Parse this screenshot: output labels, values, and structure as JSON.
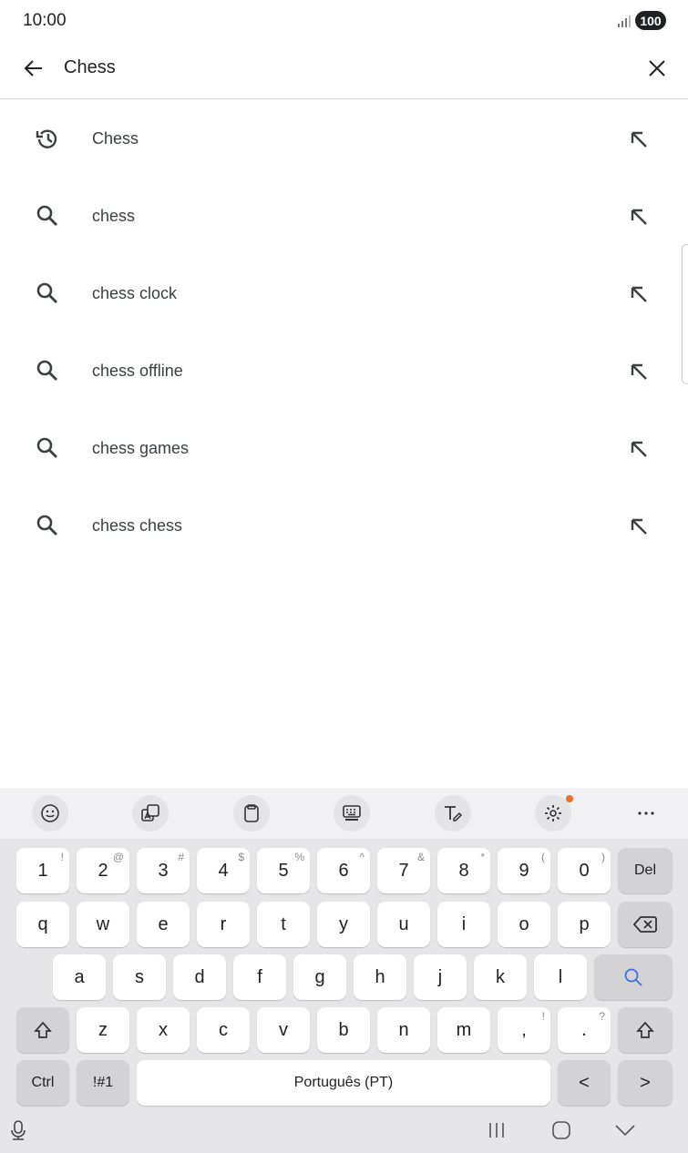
{
  "status_bar": {
    "time": "10:00",
    "battery": "100"
  },
  "search": {
    "value": "Chess"
  },
  "suggestions": [
    {
      "label": "Chess",
      "icon": "history-icon"
    },
    {
      "label": "chess",
      "icon": "search-icon"
    },
    {
      "label": "chess clock",
      "icon": "search-icon"
    },
    {
      "label": "chess offline",
      "icon": "search-icon"
    },
    {
      "label": "chess games",
      "icon": "search-icon"
    },
    {
      "label": "chess chess",
      "icon": "search-icon"
    }
  ],
  "keyboard": {
    "number_row": [
      {
        "main": "1",
        "sub": "!"
      },
      {
        "main": "2",
        "sub": "@"
      },
      {
        "main": "3",
        "sub": "#"
      },
      {
        "main": "4",
        "sub": "$"
      },
      {
        "main": "5",
        "sub": "%"
      },
      {
        "main": "6",
        "sub": "^"
      },
      {
        "main": "7",
        "sub": "&"
      },
      {
        "main": "8",
        "sub": "*"
      },
      {
        "main": "9",
        "sub": "("
      },
      {
        "main": "0",
        "sub": ")"
      }
    ],
    "del_label": "Del",
    "row_q": [
      "q",
      "w",
      "e",
      "r",
      "t",
      "y",
      "u",
      "i",
      "o",
      "p"
    ],
    "row_a": [
      "a",
      "s",
      "d",
      "f",
      "g",
      "h",
      "j",
      "k",
      "l"
    ],
    "row_z": [
      "z",
      "x",
      "c",
      "v",
      "b",
      "n",
      "m"
    ],
    "comma": {
      "main": ",",
      "sub": "!"
    },
    "period": {
      "main": ".",
      "sub": "?"
    },
    "ctrl_label": "Ctrl",
    "symbols_label": "!#1",
    "space_label": "Português (PT)",
    "left_arrow": "<",
    "right_arrow": ">"
  },
  "colors": {
    "accent": "#3d6fe0",
    "notification_dot": "#e8702a",
    "keyboard_bg": "#e6e6e8"
  }
}
